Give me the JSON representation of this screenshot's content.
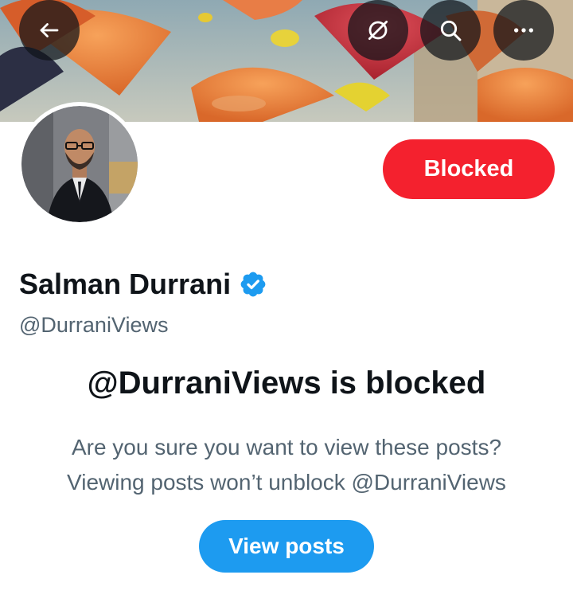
{
  "header": {
    "back_icon": "arrow-left-icon",
    "grok_icon": "grok-icon",
    "search_icon": "search-icon",
    "more_icon": "more-horizontal-icon"
  },
  "profile": {
    "display_name": "Salman Durrani",
    "handle": "@DurraniViews",
    "verified": true,
    "blocked_button_label": "Blocked"
  },
  "blocked_notice": {
    "title": "@DurraniViews is blocked",
    "line1": "Are you sure you want to view these posts?",
    "line2": "Viewing posts won’t unblock @DurraniViews",
    "view_button_label": "View posts"
  },
  "colors": {
    "blocked_red": "#f4212e",
    "primary_blue": "#1d9bf0",
    "verified_blue": "#1d9bf0",
    "secondary_text": "#536471"
  }
}
